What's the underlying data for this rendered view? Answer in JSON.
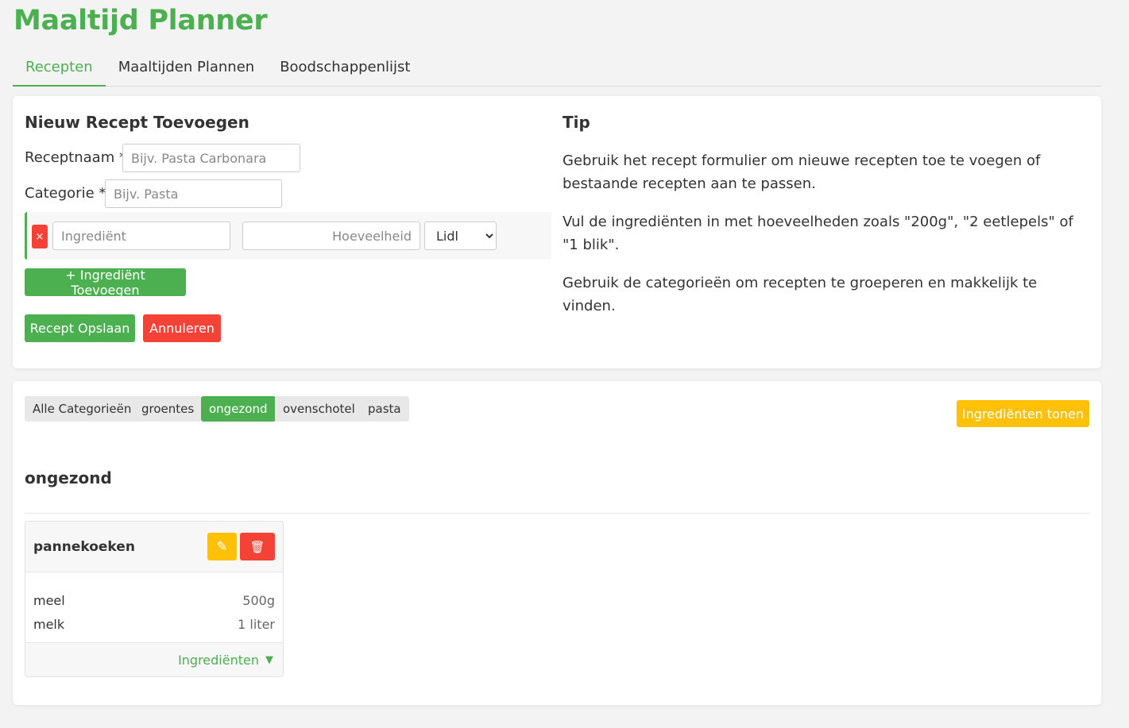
{
  "app": {
    "title": "Maaltijd Planner"
  },
  "tabs": [
    {
      "label": "Recepten",
      "active": true
    },
    {
      "label": "Maaltijden Plannen",
      "active": false
    },
    {
      "label": "Boodschappenlijst",
      "active": false
    }
  ],
  "form": {
    "title": "Nieuw Recept Toevoegen",
    "name_label": "Receptnaam *",
    "name_placeholder": "Bijv. Pasta Carbonara",
    "category_label": "Categorie *",
    "category_placeholder": "Bijv. Pasta",
    "ingredient": {
      "remove_symbol": "×",
      "name_placeholder": "Ingrediënt",
      "quantity_placeholder": "Hoeveelheid",
      "store_selected": "Lidl"
    },
    "add_ingredient_label": "+ Ingrediënt Toevoegen",
    "save_label": "Recept Opslaan",
    "cancel_label": "Annuleren"
  },
  "tip": {
    "title": "Tip",
    "paragraphs": [
      "Gebruik het recept formulier om nieuwe recepten toe te voegen of bestaande recepten aan te passen.",
      "Vul de ingrediënten in met hoeveelheden zoals \"200g\", \"2 eetlepels\" of \"1 blik\".",
      "Gebruik de categorieën om recepten te groeperen en makkelijk te vinden."
    ]
  },
  "filters": {
    "chips": [
      {
        "label": "Alle Categorieën",
        "active": false
      },
      {
        "label": "groentes",
        "active": false
      },
      {
        "label": "ongezond",
        "active": true
      },
      {
        "label": "ovenschotel",
        "active": false
      },
      {
        "label": "pasta",
        "active": false
      }
    ],
    "toggle_label": "Ingrediënten tonen"
  },
  "section": {
    "title": "ongezond",
    "recipes": [
      {
        "name": "pannekoeken",
        "edit_icon": "✎",
        "delete_icon": "🗑",
        "ingredients": [
          {
            "name": "meel",
            "quantity": "500g"
          },
          {
            "name": "melk",
            "quantity": "1 liter"
          }
        ],
        "footer_label": "Ingrediënten",
        "footer_arrow": "▼"
      }
    ]
  },
  "colors": {
    "accent": "#4caf50",
    "danger": "#f44336",
    "warning": "#ffc107"
  }
}
